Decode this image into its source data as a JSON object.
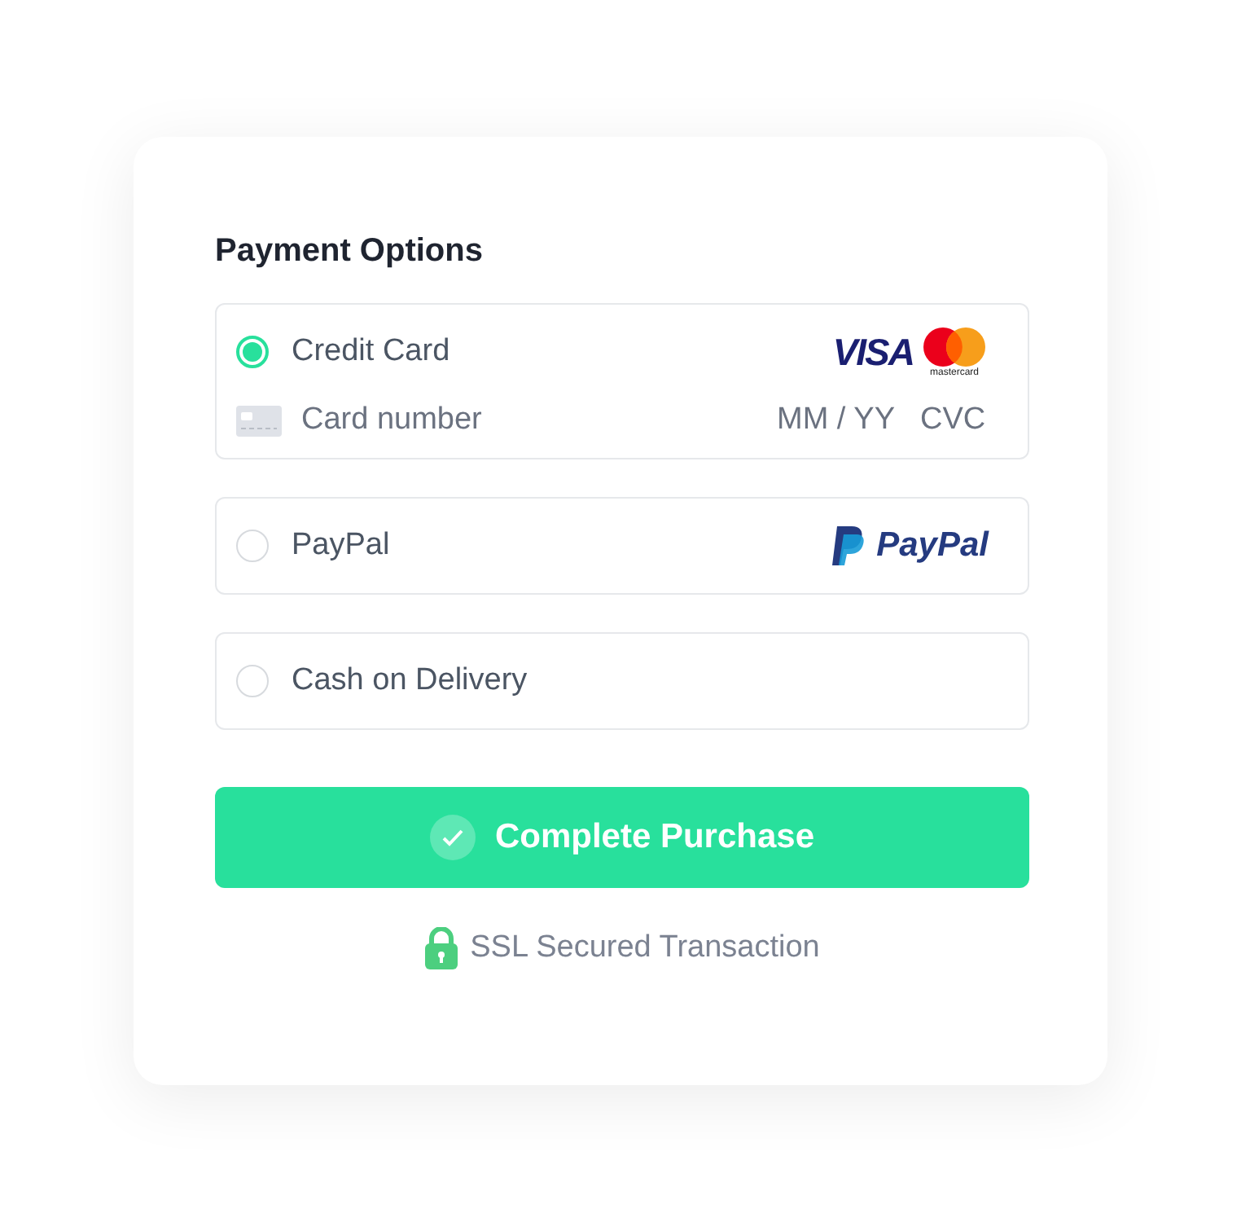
{
  "title": "Payment Options",
  "options": [
    {
      "kind": "card",
      "label": "Credit Card",
      "selected": true,
      "logos": [
        {
          "kind": "visa",
          "text": "VISA"
        },
        {
          "kind": "mastercard",
          "text": "mastercard"
        }
      ],
      "fields": {
        "number_placeholder": "Card number",
        "expiry_placeholder": "MM / YY",
        "cvc_placeholder": "CVC"
      }
    },
    {
      "kind": "paypal",
      "label": "PayPal",
      "selected": false,
      "logos": [
        {
          "kind": "paypal",
          "text": "PayPal"
        }
      ]
    },
    {
      "kind": "cash",
      "label": "Cash on Delivery",
      "selected": false
    }
  ],
  "button": "Complete Purchase",
  "security_note": "SSL Secured Transaction"
}
